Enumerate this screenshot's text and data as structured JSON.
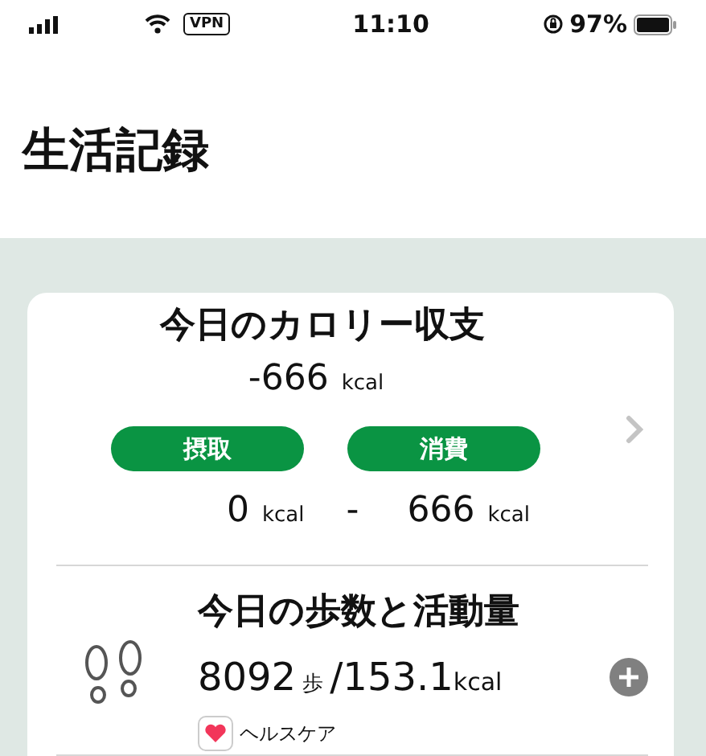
{
  "status_bar": {
    "vpn": "VPN",
    "time": "11:10",
    "battery": "97%"
  },
  "page_title": "生活記録",
  "calorie_card": {
    "title": "今日のカロリー収支",
    "balance": "-666",
    "balance_unit": "kcal",
    "intake": {
      "label": "摂取",
      "value": "0",
      "unit": "kcal"
    },
    "separator": "-",
    "burned": {
      "label": "消費",
      "value": "666",
      "unit": "kcal"
    }
  },
  "activity_card": {
    "title": "今日の歩数と活動量",
    "steps": "8092",
    "steps_unit": "歩",
    "separator": "/",
    "calories": "153.1",
    "calories_unit": "kcal",
    "source": "ヘルスケア"
  }
}
